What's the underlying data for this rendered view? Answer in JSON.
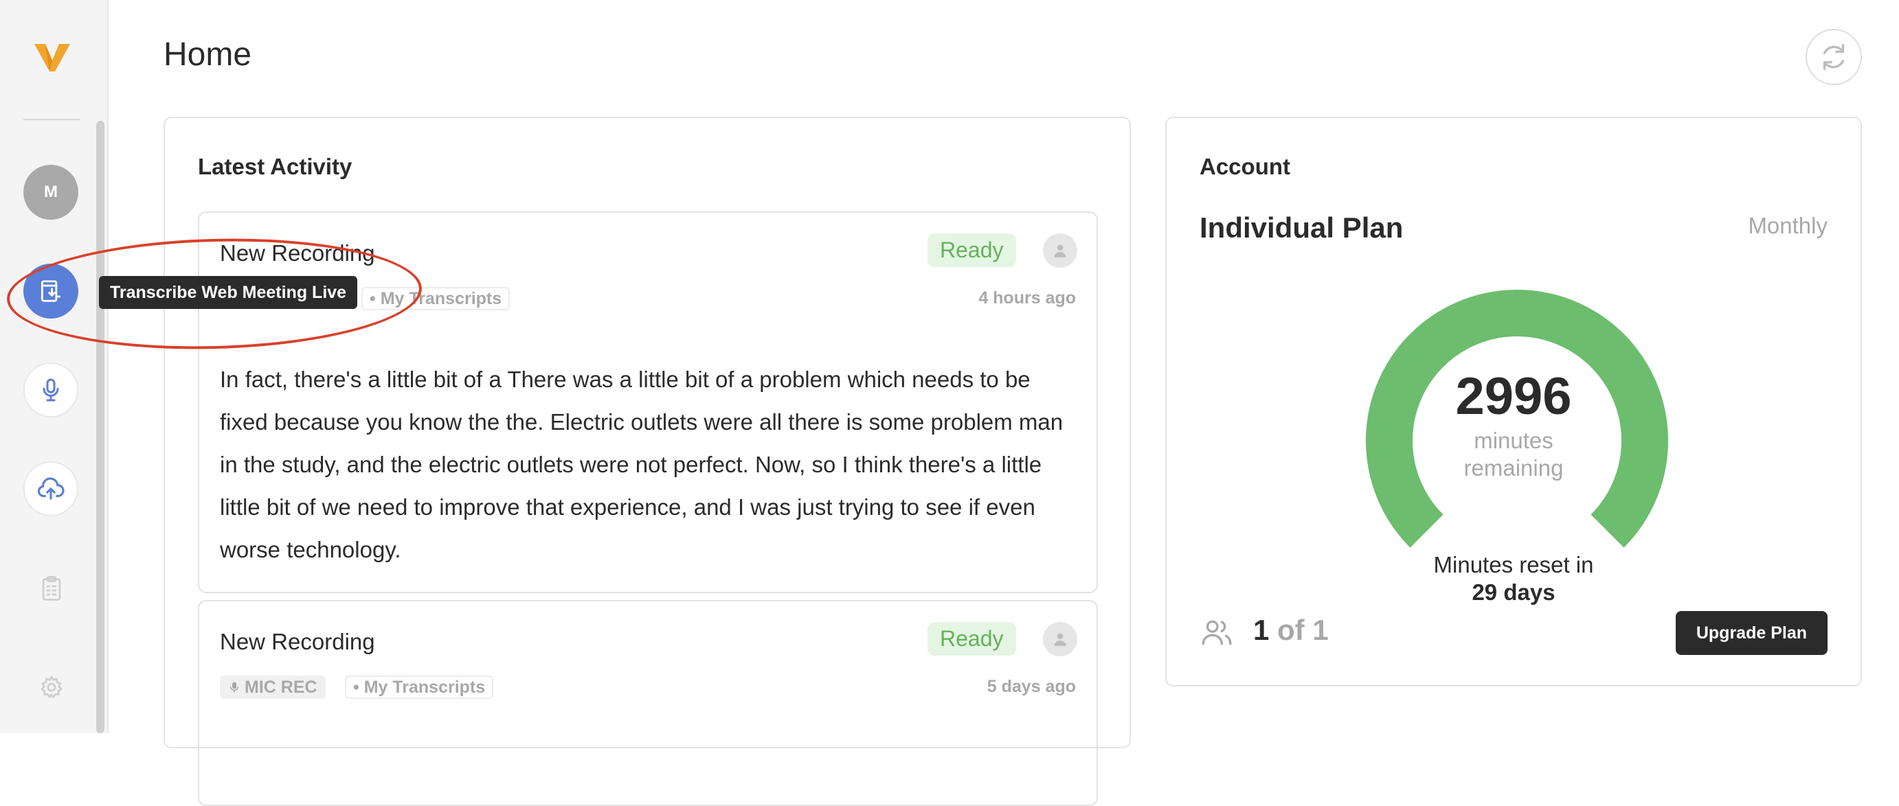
{
  "sidebar": {
    "avatar_initial": "M",
    "items": [
      {
        "name": "web-meeting",
        "icon": "web-meeting-icon"
      },
      {
        "name": "microphone",
        "icon": "microphone-icon"
      },
      {
        "name": "upload",
        "icon": "cloud-upload-icon"
      },
      {
        "name": "tasks",
        "icon": "clipboard-icon"
      },
      {
        "name": "settings",
        "icon": "gear-icon"
      }
    ],
    "tooltip": "Transcribe Web Meeting Live"
  },
  "header": {
    "title": "Home"
  },
  "activity": {
    "title": "Latest Activity",
    "recordings": [
      {
        "title": "New Recording",
        "status": "Ready",
        "folder": "• My Transcripts",
        "time": "4 hours ago",
        "text": "In fact, there's a little bit of a There was a little bit of a problem which needs to be fixed because you know the the. Electric outlets were all there is some problem man in the study, and the electric outlets were not perfect. Now, so I think there's a little little bit of we need to improve that experience, and I was just trying to see if even worse technology."
      },
      {
        "title": "New Recording",
        "status": "Ready",
        "source": "MIC REC",
        "folder": "• My Transcripts",
        "time": "5 days ago"
      }
    ]
  },
  "account": {
    "title": "Account",
    "plan_name": "Individual Plan",
    "plan_period": "Monthly",
    "minutes_remaining": "2996",
    "minutes_label_1": "minutes",
    "minutes_label_2": "remaining",
    "gauge_fraction": 1.0,
    "reset_text": "Minutes reset in",
    "reset_days": "29 days",
    "seats_used": "1",
    "seats_of": "of 1",
    "upgrade_label": "Upgrade Plan"
  },
  "colors": {
    "accent_blue": "#5a7fd8",
    "ready_green": "#63b35a",
    "gauge_green": "#6cbd6e",
    "logo_orange": "#f0a52c",
    "annotation_red": "#d9402b"
  }
}
